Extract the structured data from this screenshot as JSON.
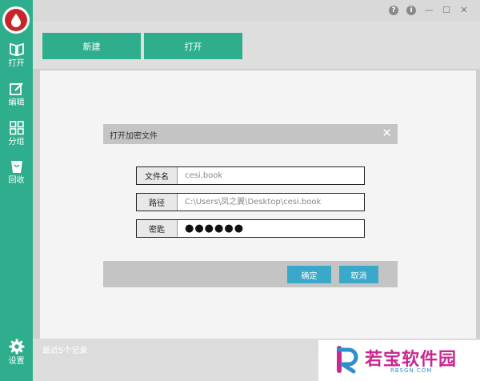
{
  "sidebar": {
    "items": [
      {
        "label": "打开",
        "icon": "book-open-icon"
      },
      {
        "label": "编辑",
        "icon": "edit-icon"
      },
      {
        "label": "分组",
        "icon": "grid-icon"
      },
      {
        "label": "回收",
        "icon": "recycle-bin-icon"
      }
    ],
    "settings_label": "设置"
  },
  "window": {
    "help_icon": "?",
    "info_icon": "i",
    "minimize_icon": "—",
    "maximize_icon": "☐",
    "close_icon": "✕"
  },
  "toolbar": {
    "new_label": "新建",
    "open_label": "打开"
  },
  "dialog": {
    "title": "打开加密文件",
    "close_icon": "✕",
    "fields": [
      {
        "label": "文件名",
        "value": "cesi.book"
      },
      {
        "label": "路径",
        "value": "C:\\Users\\凤之翼\\Desktop\\cesi.book"
      },
      {
        "label": "密匙",
        "value": "●●●●●●"
      }
    ],
    "ok_label": "确定",
    "cancel_label": "取消"
  },
  "footer": {
    "recent_text": "最近5个记录"
  },
  "watermark": {
    "brand": "若宝软件园",
    "url": "RBSGN.COM"
  },
  "colors": {
    "accent": "#2fae8d",
    "dialog_button": "#3aa8c8",
    "logo_red": "#c7262b",
    "watermark": "#c8288f"
  }
}
